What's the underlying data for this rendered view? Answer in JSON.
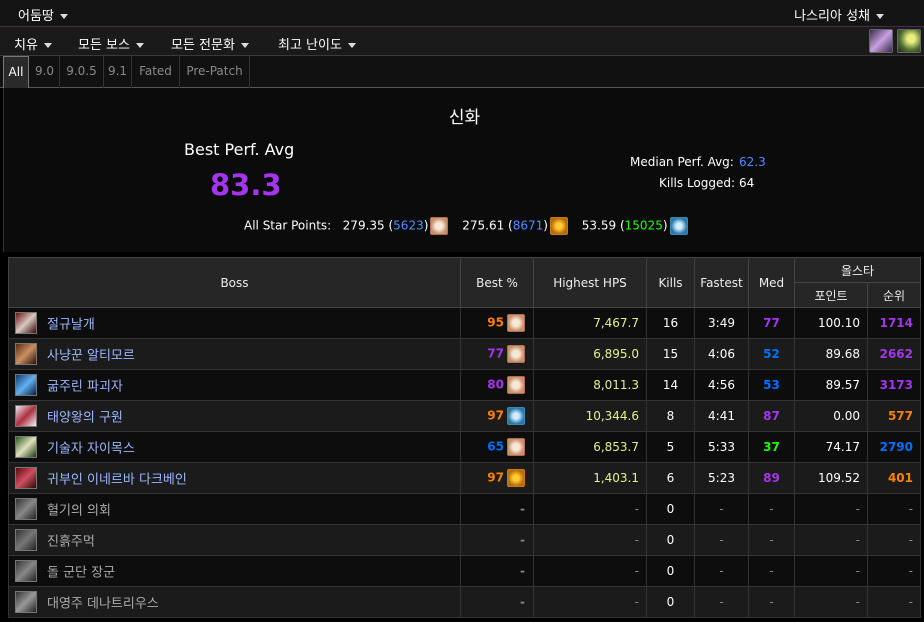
{
  "topbar": {
    "left_label": "어둠땅",
    "right_label": "나스리아 성채"
  },
  "menu": {
    "items": [
      "치유",
      "모든 보스",
      "모든 전문화",
      "최고 난이도"
    ]
  },
  "tabs": [
    "All",
    "9.0",
    "9.0.5",
    "9.1",
    "Fated",
    "Pre-Patch"
  ],
  "summary": {
    "title": "신화",
    "best_perf_label": "Best Perf. Avg",
    "best_perf_value": "83.3",
    "median_label": "Median Perf. Avg:",
    "median_value": "62.3",
    "kills_label": "Kills Logged:",
    "kills_value": "64",
    "allstar_label": "All Star Points:",
    "allstar": [
      {
        "points": "279.35",
        "rank": "5623",
        "icon": "healer-icon"
      },
      {
        "points": "275.61",
        "rank": "8671",
        "icon": "flame-icon"
      },
      {
        "points": "53.59",
        "rank": "15025",
        "icon": "frost-icon"
      }
    ]
  },
  "table": {
    "headers": {
      "boss": "Boss",
      "best": "Best %",
      "hps": "Highest HPS",
      "kills": "Kills",
      "fastest": "Fastest",
      "med": "Med",
      "allstar": "올스타",
      "points": "포인트",
      "rank": "순위"
    },
    "rows": [
      {
        "boss": "절규날개",
        "best": "95",
        "best_color": "#ff8000",
        "spec_icon": "healer-icon",
        "hps": "7,467.7",
        "kills": "16",
        "fastest": "3:49",
        "med": "77",
        "med_color": "#a335ee",
        "points": "100.10",
        "rank": "1714",
        "rank_color": "#a335ee"
      },
      {
        "boss": "사냥꾼 알티모르",
        "best": "77",
        "best_color": "#a335ee",
        "spec_icon": "healer-icon",
        "hps": "6,895.0",
        "kills": "15",
        "fastest": "4:06",
        "med": "52",
        "med_color": "#0070ff",
        "points": "89.68",
        "rank": "2662",
        "rank_color": "#a335ee"
      },
      {
        "boss": "굶주린 파괴자",
        "best": "80",
        "best_color": "#a335ee",
        "spec_icon": "healer-icon",
        "hps": "8,011.3",
        "kills": "14",
        "fastest": "4:56",
        "med": "53",
        "med_color": "#0070ff",
        "points": "89.57",
        "rank": "3173",
        "rank_color": "#a335ee"
      },
      {
        "boss": "태양왕의 구원",
        "best": "97",
        "best_color": "#ff8000",
        "spec_icon": "frost-icon",
        "hps": "10,344.6",
        "kills": "8",
        "fastest": "4:41",
        "med": "87",
        "med_color": "#a335ee",
        "points": "0.00",
        "rank": "577",
        "rank_color": "#ff8000"
      },
      {
        "boss": "기술자 자이목스",
        "best": "65",
        "best_color": "#0070ff",
        "spec_icon": "healer-icon",
        "hps": "6,853.7",
        "kills": "5",
        "fastest": "5:33",
        "med": "37",
        "med_color": "#1eff00",
        "points": "74.17",
        "rank": "2790",
        "rank_color": "#0070ff"
      },
      {
        "boss": "귀부인 이네르바 다크베인",
        "best": "97",
        "best_color": "#ff8000",
        "spec_icon": "flame-icon",
        "hps": "1,403.1",
        "kills": "6",
        "fastest": "5:23",
        "med": "89",
        "med_color": "#a335ee",
        "points": "109.52",
        "rank": "401",
        "rank_color": "#ff8000"
      },
      {
        "boss": "혈기의 의회",
        "best": "-",
        "hps": "-",
        "kills": "0",
        "fastest": "-",
        "med": "-",
        "points": "-",
        "rank": "-"
      },
      {
        "boss": "진흙주먹",
        "best": "-",
        "hps": "-",
        "kills": "0",
        "fastest": "-",
        "med": "-",
        "points": "-",
        "rank": "-"
      },
      {
        "boss": "돌 군단 장군",
        "best": "-",
        "hps": "-",
        "kills": "0",
        "fastest": "-",
        "med": "-",
        "points": "-",
        "rank": "-"
      },
      {
        "boss": "대영주 데나트리우스",
        "best": "-",
        "hps": "-",
        "kills": "0",
        "fastest": "-",
        "med": "-",
        "points": "-",
        "rank": "-"
      }
    ]
  },
  "colors": {
    "accent": "#a335ee",
    "link": "#9cb7ff",
    "hps": "#e5f08c"
  }
}
